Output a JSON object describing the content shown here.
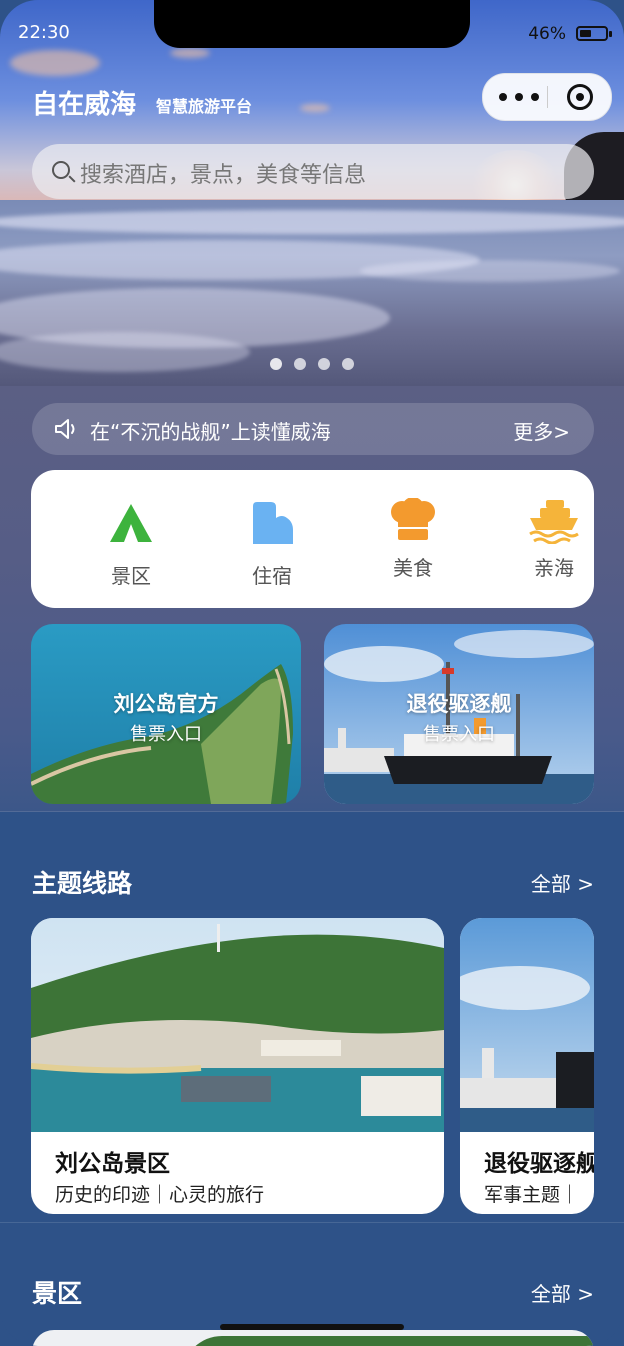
{
  "status_bar": {
    "time": "22:30",
    "battery_percent": "46%",
    "battery_level": 0.46
  },
  "header": {
    "title": "自在威海",
    "subtitle": "智慧旅游平台"
  },
  "search": {
    "placeholder": "搜索酒店，景点，美食等信息"
  },
  "banner": {
    "page_count": 4,
    "active_index": 0
  },
  "notice": {
    "text": "在“不沉的战舰”上读懂威海",
    "more": "更多>"
  },
  "categories": [
    {
      "label": "景区",
      "icon": "tent-icon",
      "color": "#3db33d"
    },
    {
      "label": "住宿",
      "icon": "hotel-icon",
      "color": "#6ab2f2"
    },
    {
      "label": "美食",
      "icon": "chef-hat-icon",
      "color": "#f39a2e"
    },
    {
      "label": "亲海",
      "icon": "ship-icon",
      "color": "#f5b43a"
    }
  ],
  "tickets": [
    {
      "title": "刘公岛官方",
      "subtitle": "售票入口"
    },
    {
      "title": "退役驱逐舰",
      "subtitle": "售票入口"
    }
  ],
  "routes_section": {
    "title": "主题线路",
    "all": "全部 >",
    "items": [
      {
        "name": "刘公岛景区",
        "desc": "历史的印迹｜心灵的旅行"
      },
      {
        "name": "退役驱逐舰",
        "desc": "军事主题｜"
      }
    ]
  },
  "spots_section": {
    "title": "景区",
    "all": "全部 >"
  }
}
